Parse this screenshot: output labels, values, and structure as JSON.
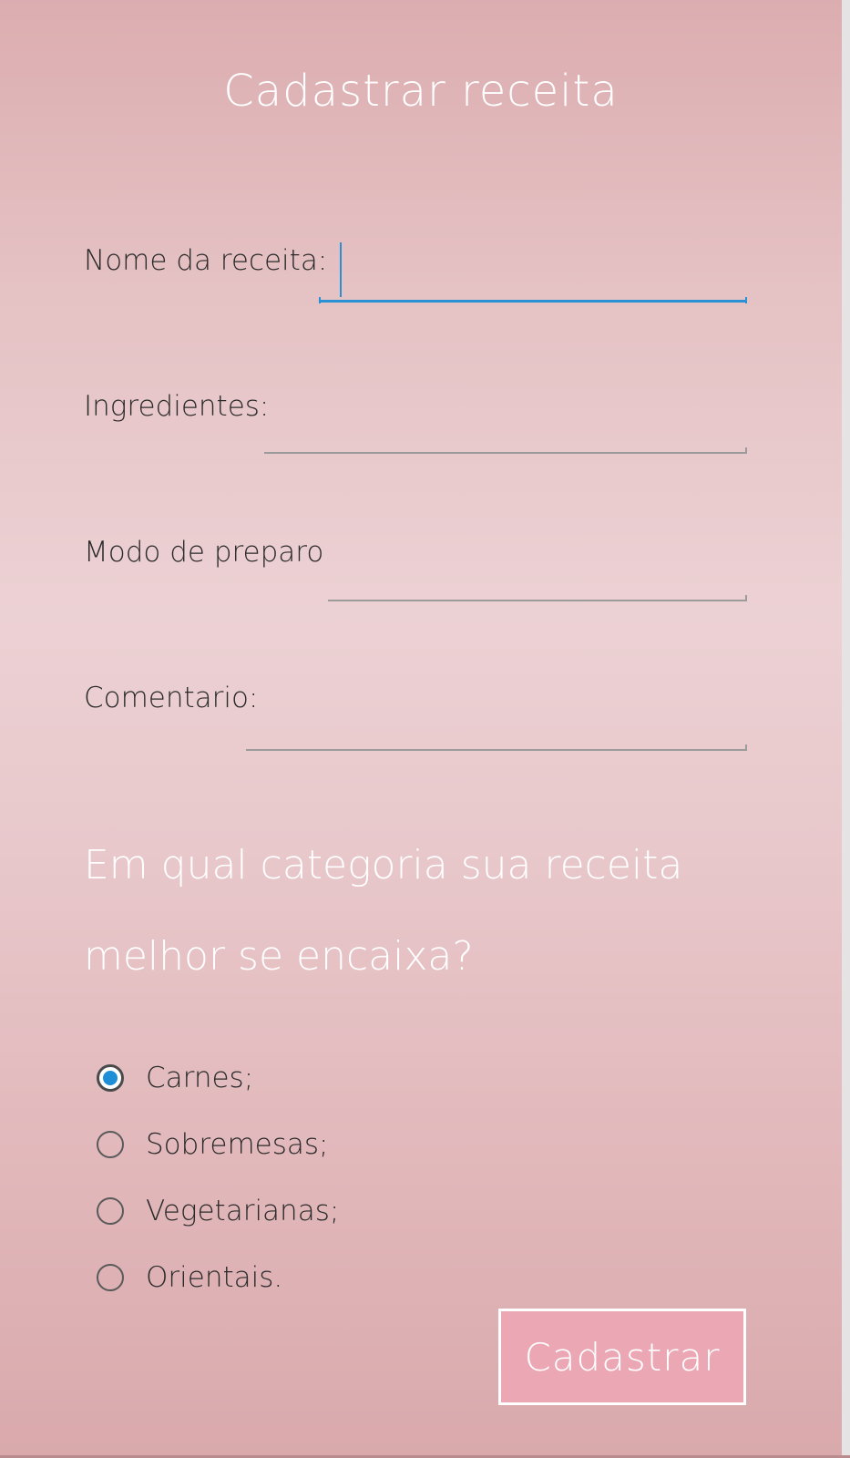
{
  "form": {
    "title": "Cadastrar receita",
    "fields": [
      {
        "label": "Nome da receita:",
        "value": "",
        "placeholder": ""
      },
      {
        "label": "Ingredientes:",
        "value": "",
        "placeholder": ""
      },
      {
        "label": "Modo de preparo",
        "value": "",
        "placeholder": ""
      },
      {
        "label": "Comentario:",
        "value": "",
        "placeholder": ""
      }
    ]
  },
  "category": {
    "question_line1": "Em qual categoria sua receita",
    "question_line2": "melhor se encaixa?",
    "options": [
      {
        "label": "Carnes;",
        "selected": true
      },
      {
        "label": "Sobremesas;",
        "selected": false
      },
      {
        "label": "Vegetarianas;",
        "selected": false
      },
      {
        "label": "Orientais.",
        "selected": false
      }
    ],
    "selected_label": "Carnes;"
  },
  "submit": {
    "label": "Cadastrar"
  },
  "colors": {
    "background_top": "#dcadb0",
    "background_mid": "#ecd1d4",
    "focus_accent": "#2b8fd4",
    "radio_selected": "#1e8fd6",
    "button_fill": "#eba7b4",
    "title_text": "#ffffff",
    "label_text": "#2a2a2a"
  }
}
